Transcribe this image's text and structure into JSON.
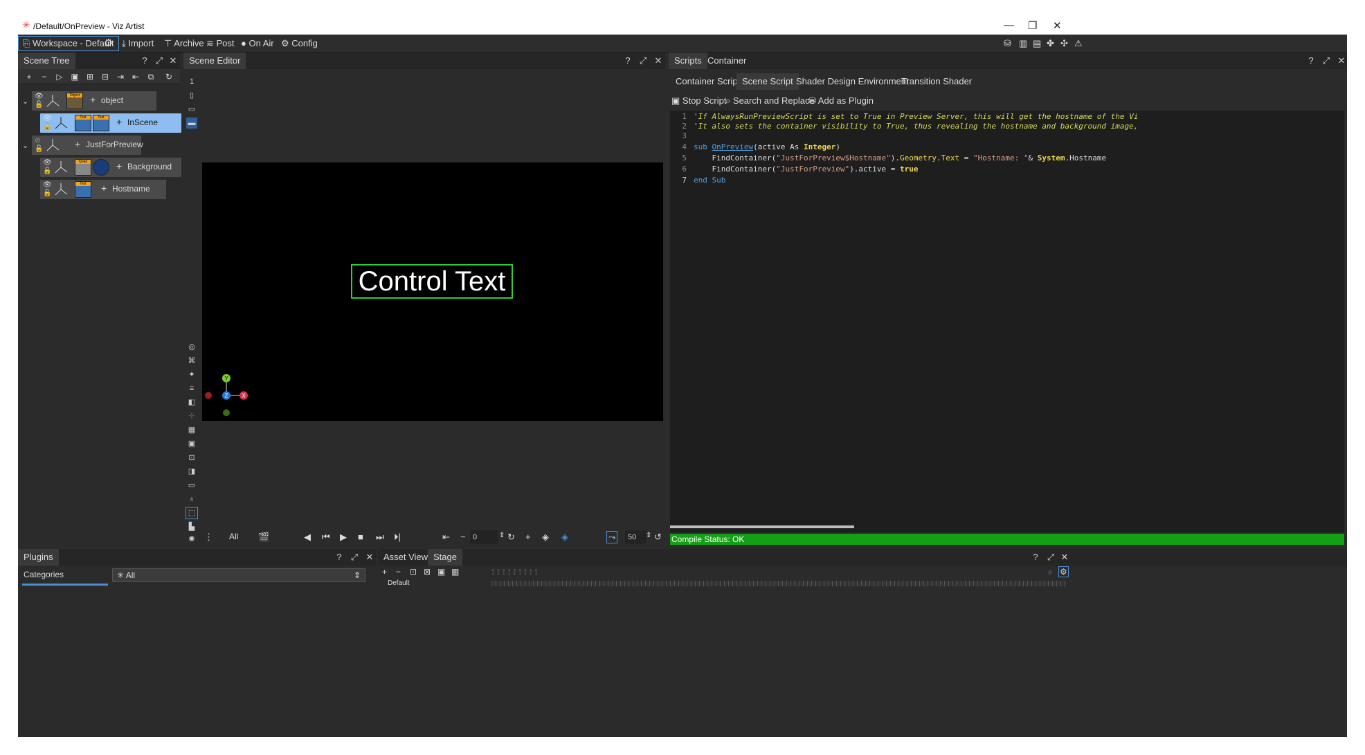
{
  "window": {
    "title": "/Default/OnPreview - Viz Artist",
    "controls": [
      "—",
      "❐",
      "✕"
    ]
  },
  "menubar": {
    "workspace": "Workspace - Default",
    "items": [
      "Import",
      "Archive",
      "Post",
      "On Air",
      "Config"
    ]
  },
  "scene_tree": {
    "tab": "Scene Tree",
    "nodes": [
      {
        "label": "object",
        "badge": "Object"
      },
      {
        "label": "InScene",
        "badge1": "Text",
        "badge2": "Text"
      },
      {
        "label": "JustForPreview"
      },
      {
        "label": "Background",
        "badge": "Quad"
      },
      {
        "label": "Hostname",
        "badge": "Text"
      }
    ]
  },
  "scene_editor": {
    "tab": "Scene Editor",
    "layer_number": "1",
    "viewport_text": "Control Text",
    "filter_label": "All",
    "frame_value": "0",
    "zoom_value": "50",
    "axis": {
      "y": "Y",
      "z": "Z",
      "x": "X"
    }
  },
  "scripts_panel": {
    "tabs": [
      "Scripts",
      "Container"
    ],
    "subtabs": [
      "Container Script",
      "Scene Script",
      "Shader Design Environment",
      "Transition Shader"
    ],
    "actions": [
      "Stop Script",
      "Search and Replace",
      "Add as Plugin"
    ],
    "code": {
      "line_numbers": [
        "1",
        "2",
        "3",
        "4",
        "5",
        "6",
        "7"
      ],
      "l1": "'If AlwaysRunPreviewScript is set to True in Preview Server, this will get the hostname of the Vi",
      "l2": "'It also sets the container visibility to True, thus revealing the hostname and background image,",
      "l4_sub": "sub ",
      "l4_fn": "OnPreview",
      "l4_a": "(active As ",
      "l4_type": "Integer",
      "l4_b": ")",
      "l5_a": "    FindContainer(",
      "l5_str": "\"JustForPreview$Hostname\"",
      "l5_b": ").",
      "l5_prop": "Geometry.Text",
      "l5_c": " = ",
      "l5_str2": "\"Hostname: \"",
      "l5_d": "& ",
      "l5_sys": "System",
      "l5_e": ".Hostname",
      "l6_a": "    FindContainer(",
      "l6_str": "\"JustForPreview\"",
      "l6_b": ").active = ",
      "l6_true": "true",
      "l7": "end Sub"
    },
    "compile_status": "Compile Status: OK"
  },
  "plugins_panel": {
    "tab": "Plugins",
    "categories_label": "Categories",
    "filter_value": "All"
  },
  "stage_panel": {
    "tabs": [
      "Asset View",
      "Stage"
    ],
    "director": "Default"
  },
  "colors": {
    "selection": "#8fbdf0",
    "compile_ok": "#14a014",
    "viewport_bbox": "#2fcf2f"
  }
}
